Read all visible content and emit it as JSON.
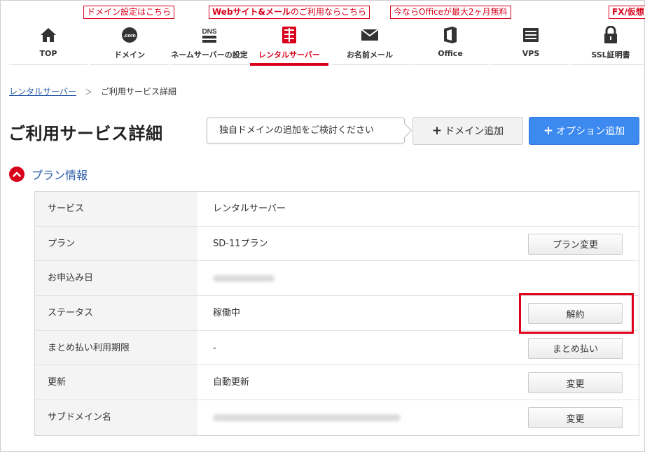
{
  "callouts": {
    "domain": "ドメイン設定はこちら",
    "web_bold": "Webサイト&メール",
    "web_rest": "のご利用ならこちら",
    "office": "今ならOfficeが最大2ヶ月無料",
    "fx": "FX/仮想"
  },
  "nav": {
    "items": [
      {
        "label": "TOP",
        "icon": "home-icon"
      },
      {
        "label": "ドメイン",
        "icon": "dotcom-icon",
        "icon_text": ".com"
      },
      {
        "label": "ネームサーバーの設定",
        "icon": "dns-icon",
        "icon_text": "DNS"
      },
      {
        "label": "レンタルサーバー",
        "icon": "server-icon"
      },
      {
        "label": "お名前メール",
        "icon": "mail-icon"
      },
      {
        "label": "Office",
        "icon": "office-icon"
      },
      {
        "label": "VPS",
        "icon": "vps-icon"
      },
      {
        "label": "SSL証明書",
        "icon": "lock-icon"
      }
    ],
    "active_index": 3
  },
  "breadcrumb": {
    "parent": "レンタルサーバー",
    "separator": "＞",
    "current": "ご利用サービス詳細"
  },
  "header": {
    "title": "ご利用サービス詳細",
    "tooltip": "独自ドメインの追加をご検討ください",
    "add_domain_label": "ドメイン追加",
    "add_option_label": "オプション追加"
  },
  "section": {
    "title": "プラン情報"
  },
  "table": {
    "rows": [
      {
        "key": "サービス",
        "value": "レンタルサーバー"
      },
      {
        "key": "プラン",
        "value": "SD-11プラン",
        "button": "プラン変更"
      },
      {
        "key": "お申込み日",
        "value": ""
      },
      {
        "key": "ステータス",
        "value": "稼働中",
        "button": "解約"
      },
      {
        "key": "まとめ払い利用期限",
        "value": "-",
        "button": "まとめ払い"
      },
      {
        "key": "更新",
        "value": "自動更新",
        "button": "変更"
      },
      {
        "key": "サブドメイン名",
        "value": "",
        "button": "変更"
      }
    ]
  },
  "colors": {
    "accent_red": "#d9001b",
    "link_blue": "#2a5ca8",
    "primary_blue": "#3c8af0"
  }
}
